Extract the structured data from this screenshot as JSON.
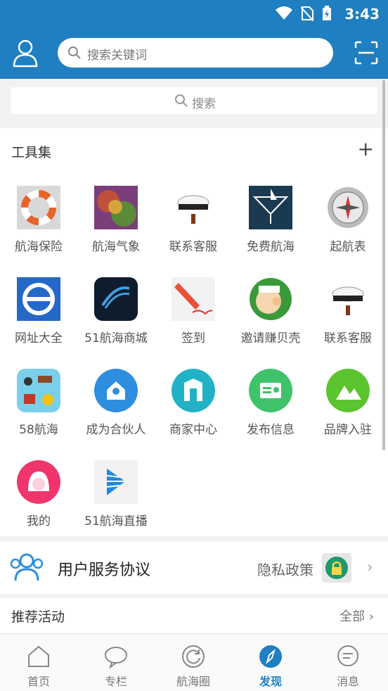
{
  "status": {
    "time": "3:43"
  },
  "header": {
    "search_placeholder": "搜索关键词"
  },
  "search2": {
    "label": "搜索"
  },
  "tools": {
    "title": "工具集",
    "items": [
      {
        "label": "航海保险"
      },
      {
        "label": "航海气象"
      },
      {
        "label": "联系客服"
      },
      {
        "label": "免费航海"
      },
      {
        "label": "起航表"
      },
      {
        "label": "网址大全"
      },
      {
        "label": "51航海商城"
      },
      {
        "label": "签到"
      },
      {
        "label": "邀请赚贝壳"
      },
      {
        "label": "联系客服"
      },
      {
        "label": "58航海"
      },
      {
        "label": "成为合伙人"
      },
      {
        "label": "商家中心"
      },
      {
        "label": "发布信息"
      },
      {
        "label": "品牌入驻"
      },
      {
        "label": "我的"
      },
      {
        "label": "51航海直播"
      }
    ]
  },
  "agreement": {
    "user_service": "用户服务协议",
    "privacy": "隐私政策"
  },
  "recommend": {
    "title": "推荐活动",
    "all": "全部"
  },
  "tabs": [
    {
      "label": "首页"
    },
    {
      "label": "专栏"
    },
    {
      "label": "航海圈"
    },
    {
      "label": "发现"
    },
    {
      "label": "消息"
    }
  ],
  "colors": {
    "brand": "#1f7fc0"
  }
}
